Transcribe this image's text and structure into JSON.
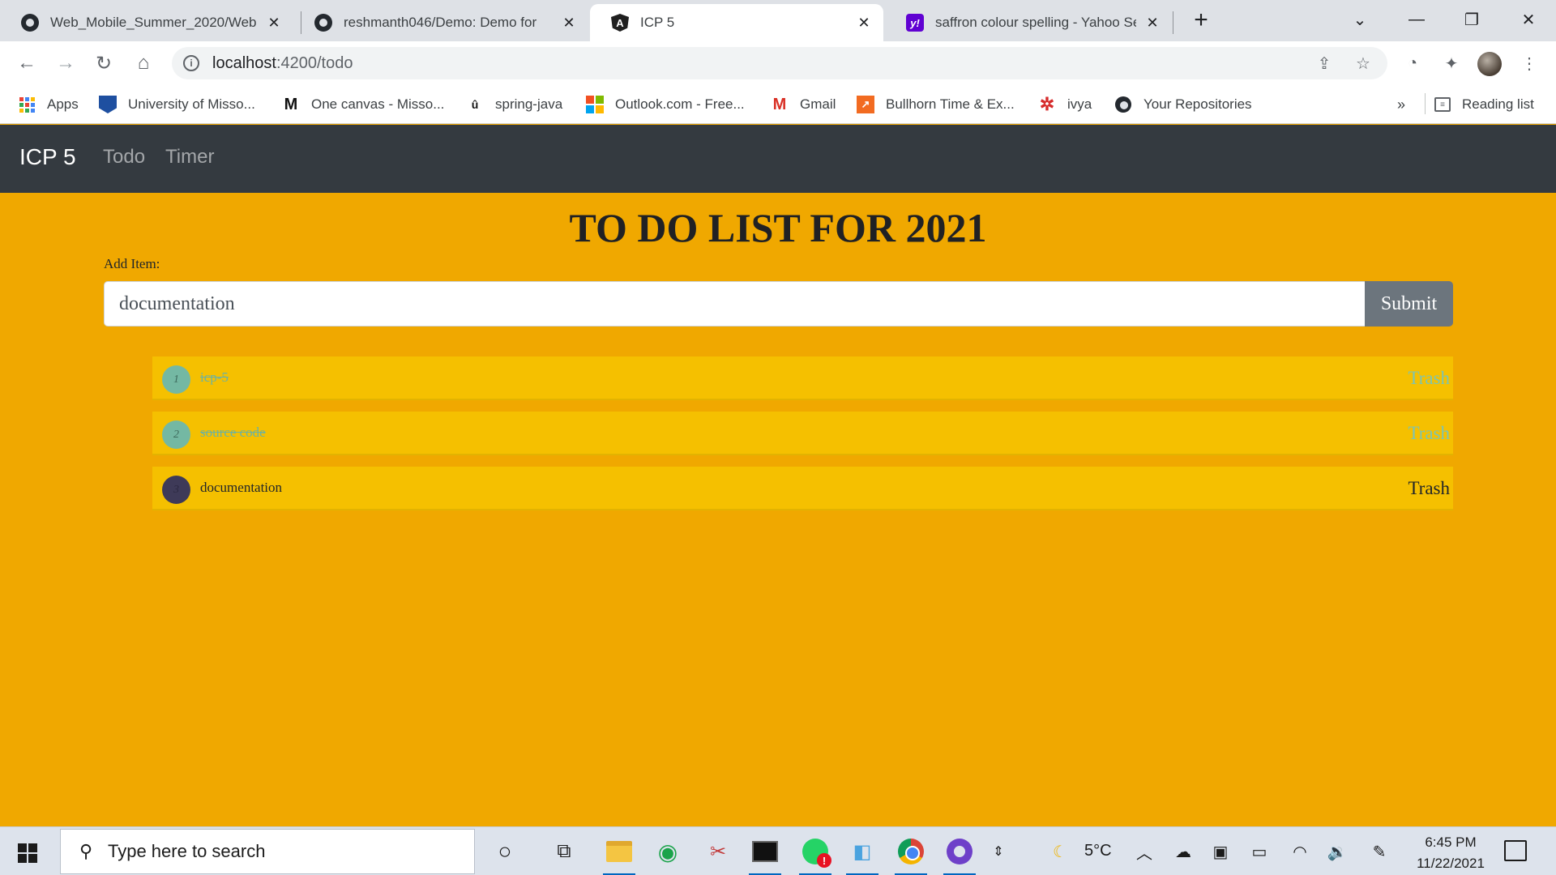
{
  "browser": {
    "tabs": [
      {
        "title": "Web_Mobile_Summer_2020/Web",
        "icon": "github-icon",
        "active": false
      },
      {
        "title": "reshmanth046/Demo: Demo for",
        "icon": "github-icon",
        "active": false
      },
      {
        "title": "ICP 5",
        "icon": "angular-icon",
        "active": true
      },
      {
        "title": "saffron colour spelling - Yahoo Se",
        "icon": "yahoo-icon",
        "active": false
      }
    ],
    "address": {
      "host": "localhost",
      "path": ":4200/todo"
    },
    "bookmarks": [
      {
        "label": "Apps",
        "icon": "apps-grid-icon"
      },
      {
        "label": "University of Misso...",
        "icon": "mizzou-icon"
      },
      {
        "label": "One canvas - Misso...",
        "icon": "canvas-m-icon"
      },
      {
        "label": "spring-java",
        "icon": "spring-icon"
      },
      {
        "label": "Outlook.com - Free...",
        "icon": "microsoft-icon"
      },
      {
        "label": "Gmail",
        "icon": "gmail-icon"
      },
      {
        "label": "Bullhorn Time & Ex...",
        "icon": "bullhorn-icon"
      },
      {
        "label": "ivya",
        "icon": "ivya-icon"
      },
      {
        "label": "Your Repositories",
        "icon": "github-icon"
      }
    ],
    "overflow_label": "»",
    "reading_list_label": "Reading list"
  },
  "app": {
    "brand": "ICP 5",
    "nav": [
      {
        "label": "Todo"
      },
      {
        "label": "Timer"
      }
    ],
    "title": "TO DO LIST FOR 2021",
    "add_label": "Add Item:",
    "input_value": "documentation",
    "submit_label": "Submit",
    "todos": [
      {
        "index": "1",
        "text": "icp-5",
        "done": true,
        "trash_label": "Trash"
      },
      {
        "index": "2",
        "text": "source code",
        "done": true,
        "trash_label": "Trash"
      },
      {
        "index": "3",
        "text": "documentation",
        "done": false,
        "trash_label": "Trash"
      }
    ],
    "colors": {
      "background": "#f0a800",
      "row": "#f5c000",
      "navbar": "#343a40",
      "done_text": "#6db2a0",
      "submit": "#6c757d"
    }
  },
  "taskbar": {
    "search_placeholder": "Type here to search",
    "weather_temp": "5°C",
    "time": "6:45 PM",
    "date": "11/22/2021"
  }
}
